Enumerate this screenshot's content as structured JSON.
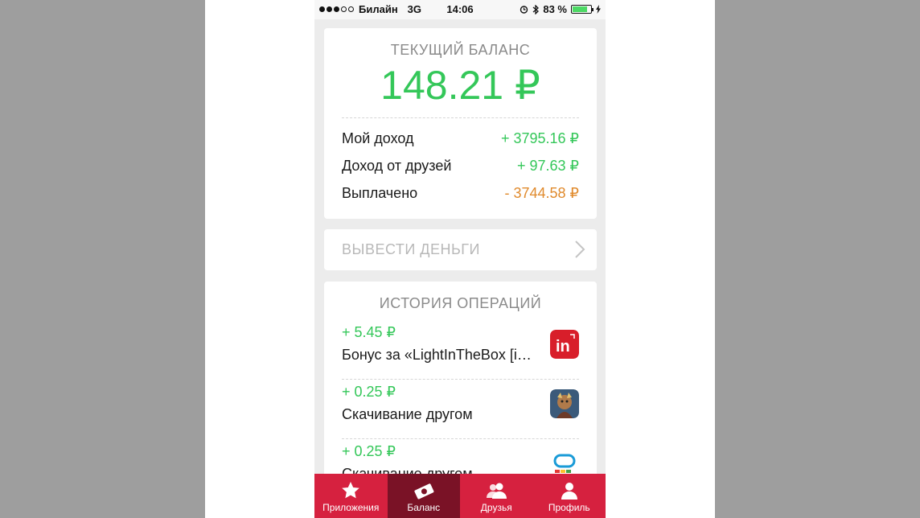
{
  "status_bar": {
    "carrier": "Билайн",
    "network": "3G",
    "time": "14:06",
    "battery": "83 %",
    "battery_level": 0.83
  },
  "balance": {
    "title": "ТЕКУЩИЙ БАЛАНС",
    "amount": "148.21 ₽",
    "rows": [
      {
        "label": "Мой доход",
        "value": "+ 3795.16 ₽",
        "color": "#34c759"
      },
      {
        "label": "Доход от друзей",
        "value": "+ 97.63 ₽",
        "color": "#34c759"
      },
      {
        "label": "Выплачено",
        "value": "- 3744.58 ₽",
        "color": "#e08a2c"
      }
    ]
  },
  "withdraw": {
    "label": "ВЫВЕСТИ ДЕНЬГИ"
  },
  "history": {
    "title": "ИСТОРИЯ ОПЕРАЦИЙ",
    "items": [
      {
        "amount": "+ 5.45 ₽",
        "desc": "Бонус за «LightInTheBox [i…",
        "icon": "lightinthebox-app-icon"
      },
      {
        "amount": "+ 0.25 ₽",
        "desc": "Скачивание другом",
        "icon": "game-app-icon"
      },
      {
        "amount": "+ 0.25 ₽",
        "desc": "Скачивание другом",
        "icon": "app-icon"
      }
    ]
  },
  "tabs": [
    {
      "label": "Приложения",
      "icon": "star-icon",
      "active": false
    },
    {
      "label": "Баланс",
      "icon": "money-icon",
      "active": true
    },
    {
      "label": "Друзья",
      "icon": "friends-icon",
      "active": false
    },
    {
      "label": "Профиль",
      "icon": "profile-icon",
      "active": false
    }
  ],
  "colors": {
    "accent": "#d6213f",
    "active_tab": "#7a1226",
    "income": "#34c759",
    "payout": "#e08a2c"
  }
}
